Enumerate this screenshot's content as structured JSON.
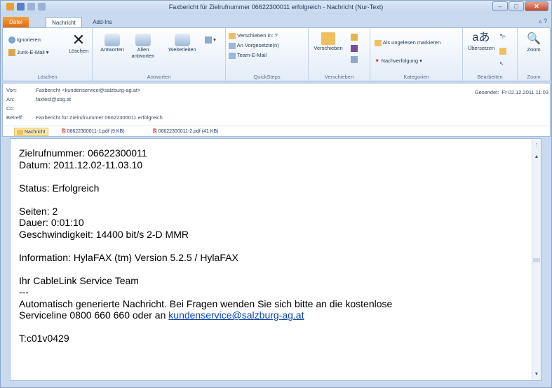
{
  "window": {
    "title": "Faxbericht für Zielrufnummer 06622300011 erfolgreich - Nachricht (Nur-Text)"
  },
  "tabs": {
    "file": "Datei",
    "message": "Nachricht",
    "addins": "Add-Ins"
  },
  "ribbon": {
    "delete": {
      "ignore": "Ignorieren",
      "junk": "Junk-E-Mail",
      "delete": "Löschen",
      "label": "Löschen"
    },
    "respond": {
      "reply": "Antworten",
      "reply_all_1": "Allen",
      "reply_all_2": "antworten",
      "forward": "Weiterleiten",
      "label": "Antworten"
    },
    "quicksteps": {
      "move_to": "Verschieben in: ?",
      "to_manager": "An Vorgesetzte(n)",
      "team_email": "Team-E-Mail",
      "label": "QuickSteps"
    },
    "move": {
      "move": "Verschieben",
      "label": "Verschieben"
    },
    "tags": {
      "mark_unread": "Als ungelesen markieren",
      "followup": "Nachverfolgung",
      "label": "Kategorien"
    },
    "editing": {
      "translate": "Übersetzen",
      "label": "Bearbeiten"
    },
    "zoom": {
      "zoom": "Zoom",
      "label": "Zoom"
    }
  },
  "header": {
    "from_label": "Von:",
    "from": "Faxbericht <kundenservice@salzburg-ag.at>",
    "to_label": "An:",
    "to": "faxtest@sbg.at",
    "cc_label": "Cc:",
    "cc": "",
    "subject_label": "Betreff:",
    "subject": "Faxbericht für Zielrufnummer 06622300011 erfolgreich",
    "sent_label": "Gesendet:",
    "sent": "Fr 02.12.2011 11:03"
  },
  "attachments": {
    "message_tab": "Nachricht",
    "files": [
      "06622300011-1.pdf (9 KB)",
      "06622300011-2.pdf (41 KB)"
    ]
  },
  "body": {
    "line1": "Zielrufnummer: 06622300011",
    "line2": "Datum: 2011.12.02-11.03.10",
    "line3": "Status: Erfolgreich",
    "line4": "Seiten: 2",
    "line5": "Dauer: 0:01:10",
    "line6": "Geschwindigkeit: 14400 bit/s 2-D MMR",
    "line7": "Information: HylaFAX (tm) Version 5.2.5 / HylaFAX",
    "line8": "Ihr CableLink Service Team",
    "line9": "---",
    "line10": "Automatisch generierte Nachricht. Bei Fragen wenden Sie sich bitte an die kostenlose",
    "line11_pre": "Serviceline 0800 660 660 oder an ",
    "link": "kundenservice@salzburg-ag.at",
    "line12": "T:c01v0429"
  },
  "colors": {
    "accent": "#e36c0a",
    "ribbon_border": "#a3bcd9",
    "link": "#0645ad"
  }
}
